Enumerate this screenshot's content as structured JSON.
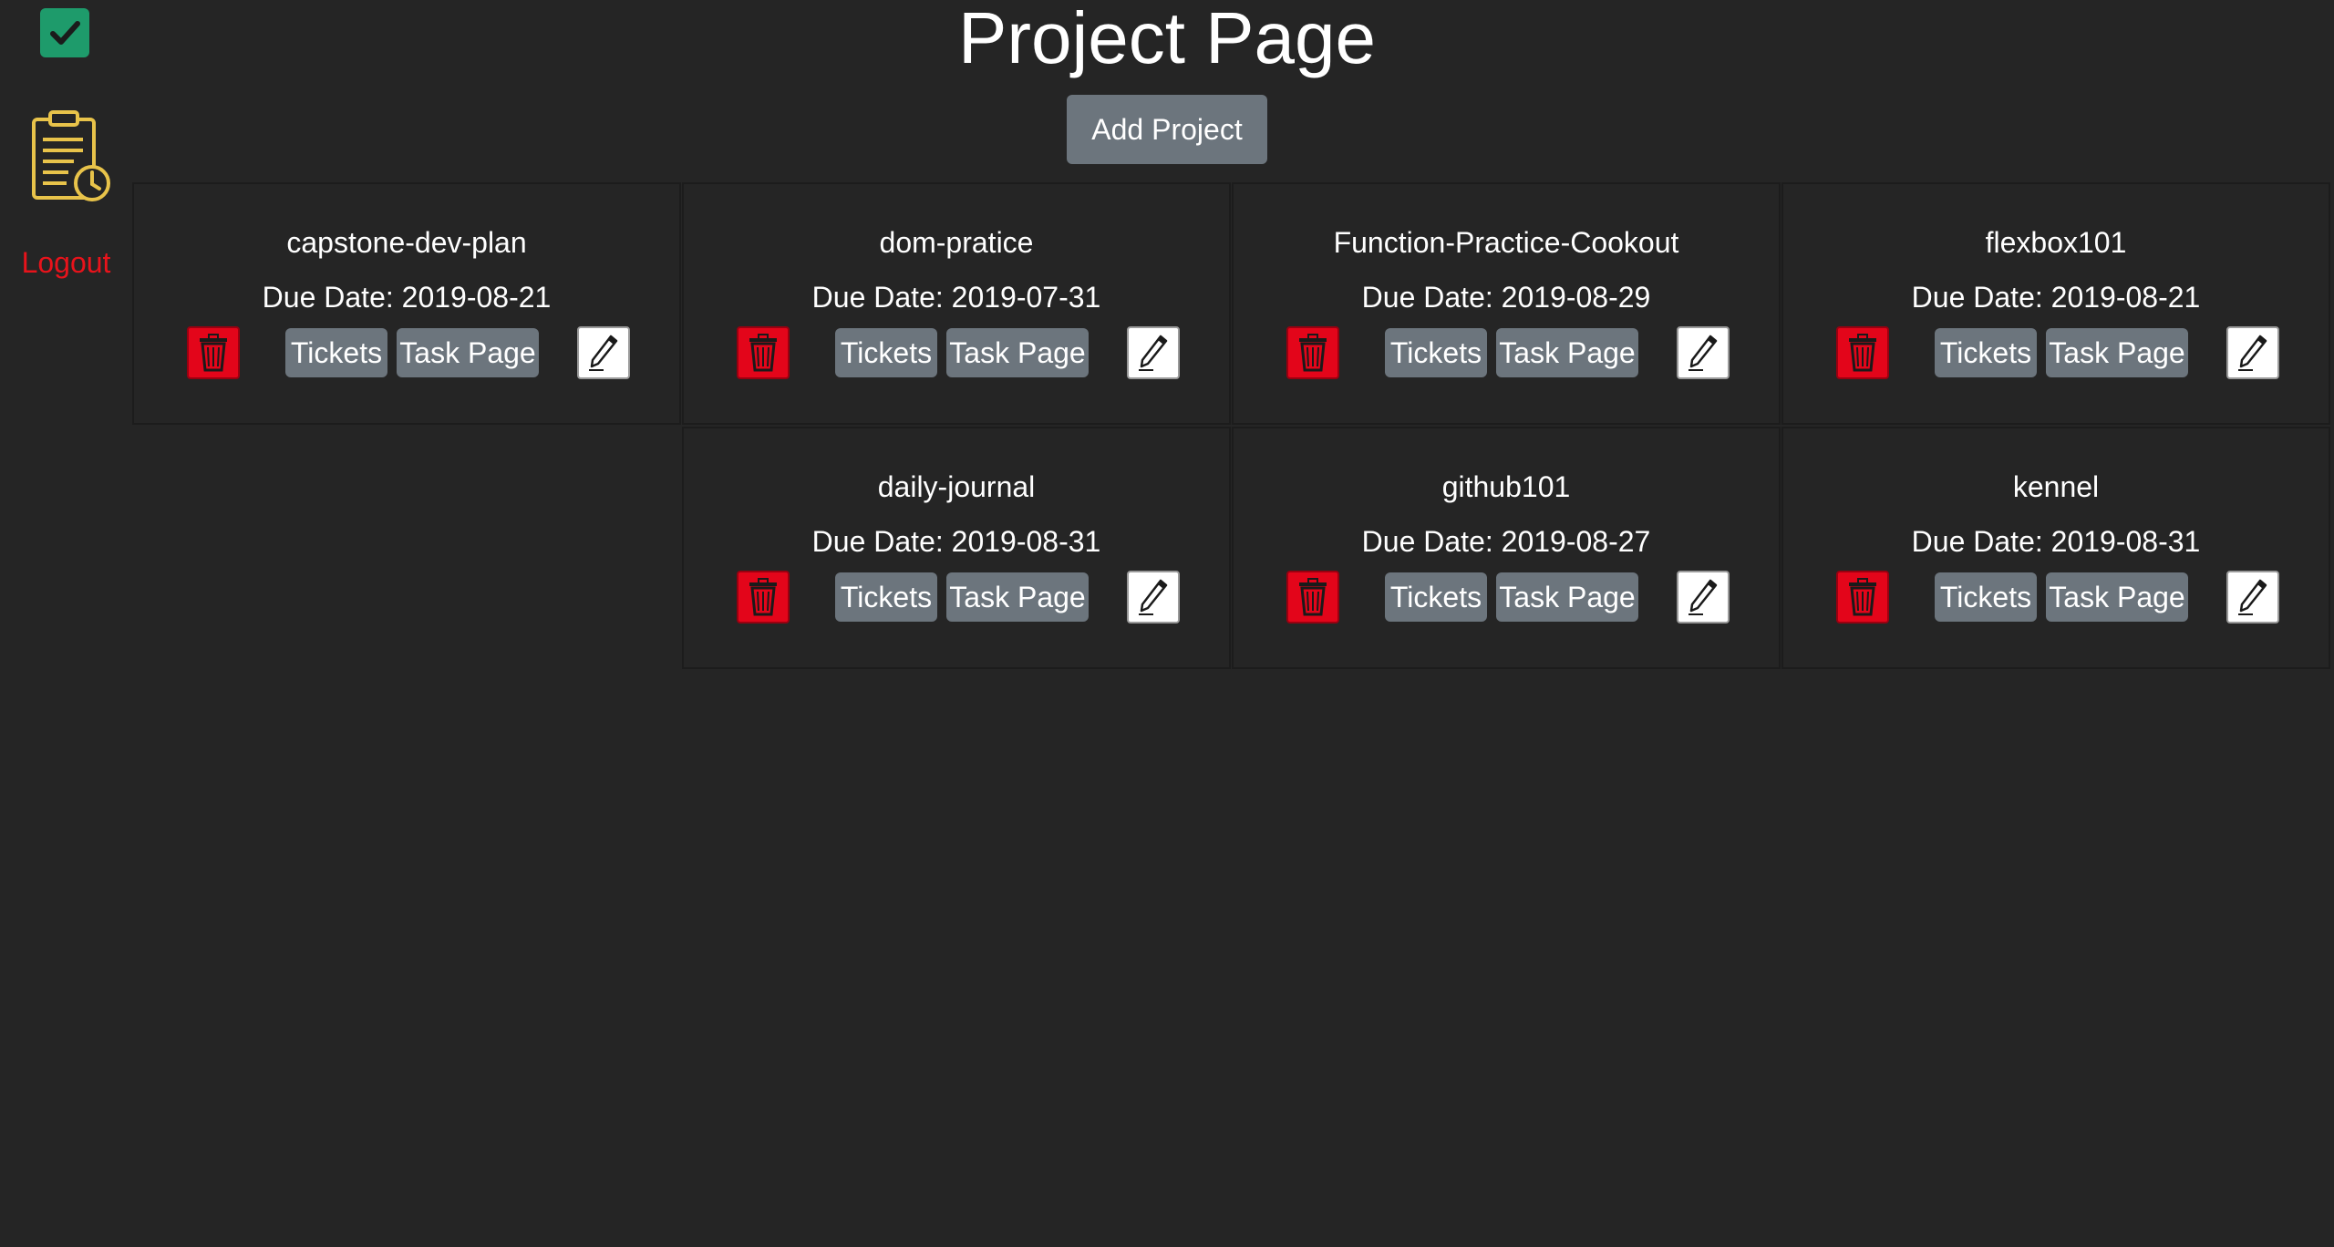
{
  "page": {
    "title": "Project Page",
    "add_project_label": "Add Project"
  },
  "sidebar": {
    "logo_icon": "checkmark-icon",
    "nav_icon": "clipboard-clock-icon",
    "logout_label": "Logout"
  },
  "colors": {
    "background": "#252525",
    "logo_green": "#1e9b6b",
    "logout_red": "#e8131b",
    "delete_red": "#e3051a",
    "button_gray": "#6c757d",
    "clipboard_yellow": "#e8c34a"
  },
  "projects": [
    {
      "name": "capstone-dev-plan",
      "due": "Due Date: 2019-08-21",
      "tickets_label": "Tickets",
      "taskpage_label": "Task Page"
    },
    {
      "name": "dom-pratice",
      "due": "Due Date: 2019-07-31",
      "tickets_label": "Tickets",
      "taskpage_label": "Task Page"
    },
    {
      "name": "Function-Practice-Cookout",
      "due": "Due Date: 2019-08-29",
      "tickets_label": "Tickets",
      "taskpage_label": "Task Page"
    },
    {
      "name": "flexbox101",
      "due": "Due Date: 2019-08-21",
      "tickets_label": "Tickets",
      "taskpage_label": "Task Page"
    },
    {
      "name": "daily-journal",
      "due": "Due Date: 2019-08-31",
      "tickets_label": "Tickets",
      "taskpage_label": "Task Page"
    },
    {
      "name": "github101",
      "due": "Due Date: 2019-08-27",
      "tickets_label": "Tickets",
      "taskpage_label": "Task Page"
    },
    {
      "name": "kennel",
      "due": "Due Date: 2019-08-31",
      "tickets_label": "Tickets",
      "taskpage_label": "Task Page"
    }
  ]
}
